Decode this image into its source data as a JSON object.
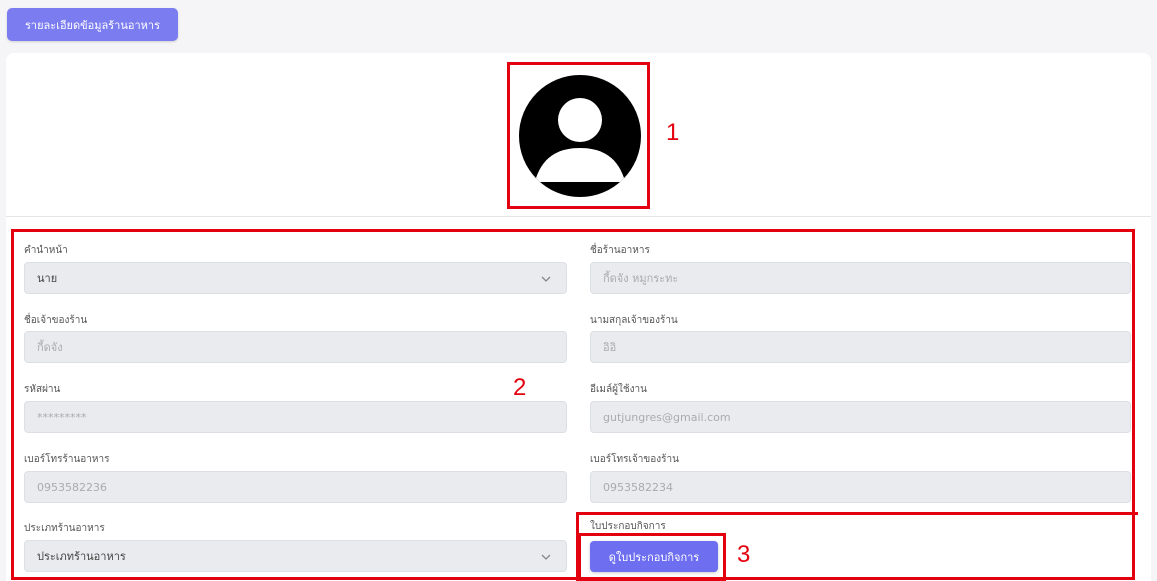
{
  "header": {
    "title": "รายละเอียดข้อมูลร้านอาหาร"
  },
  "avatar": {
    "icon": "user-avatar-icon"
  },
  "annotations": {
    "n1": "1",
    "n2": "2",
    "n3": "3",
    "color": "#e3000f"
  },
  "form": {
    "prefix": {
      "label": "คำนำหน้า",
      "value": "นาย"
    },
    "restaurant_name": {
      "label": "ชื่อร้านอาหาร",
      "value": "กี้ดจัง หมูกระทะ"
    },
    "owner_first_name": {
      "label": "ชื่อเจ้าของร้าน",
      "value": "กี้ดจัง"
    },
    "owner_last_name": {
      "label": "นามสกุลเจ้าของร้าน",
      "value": "อิอิ"
    },
    "password": {
      "label": "รหัสผ่าน",
      "value": "*********"
    },
    "email": {
      "label": "อีเมล์ผู้ใช้งาน",
      "value": "gutjungres@gmail.com"
    },
    "restaurant_phone": {
      "label": "เบอร์โทรร้านอาหาร",
      "value": "0953582236"
    },
    "owner_phone": {
      "label": "เบอร์โทรเจ้าของร้าน",
      "value": "0953582234"
    },
    "restaurant_type": {
      "label": "ประเภทร้านอาหาร",
      "value": "ประเภทร้านอาหาร"
    },
    "license": {
      "label": "ใบประกอบกิจการ",
      "button": "ดูใบประกอบกิจการ"
    }
  },
  "colors": {
    "accent": "#6e6ef0",
    "header_button": "#7b7cf0",
    "field_bg": "#e9ebee"
  }
}
